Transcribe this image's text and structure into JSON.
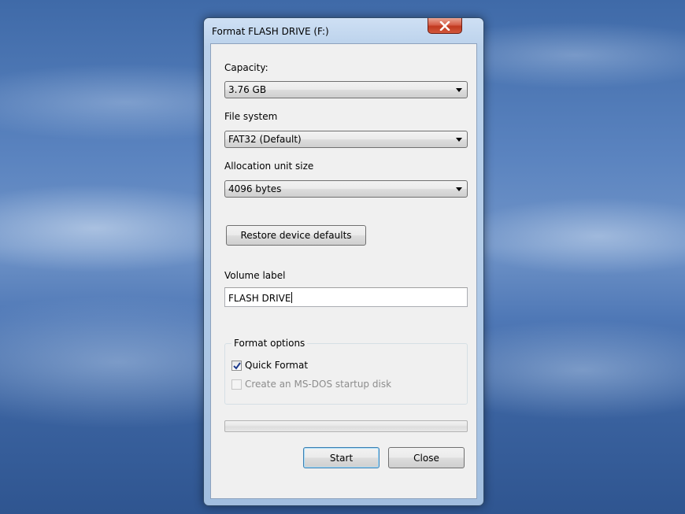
{
  "dialog": {
    "title": "Format FLASH DRIVE (F:)",
    "capacity": {
      "label": "Capacity:",
      "value": "3.76 GB"
    },
    "file_system": {
      "label": "File system",
      "value": "FAT32 (Default)"
    },
    "allocation": {
      "label": "Allocation unit size",
      "value": "4096 bytes"
    },
    "restore_button": "Restore device defaults",
    "volume_label": {
      "label": "Volume label",
      "value": "FLASH DRIVE"
    },
    "format_options": {
      "title": "Format options",
      "quick_format": {
        "label": "Quick Format",
        "checked": true,
        "enabled": true
      },
      "msdos_startup": {
        "label": "Create an MS-DOS startup disk",
        "checked": false,
        "enabled": false
      }
    },
    "progress": 0,
    "start_button": "Start",
    "close_button": "Close"
  },
  "icons": {
    "close": "close-icon",
    "dropdown": "chevron-down-icon",
    "check": "checkmark-icon"
  }
}
